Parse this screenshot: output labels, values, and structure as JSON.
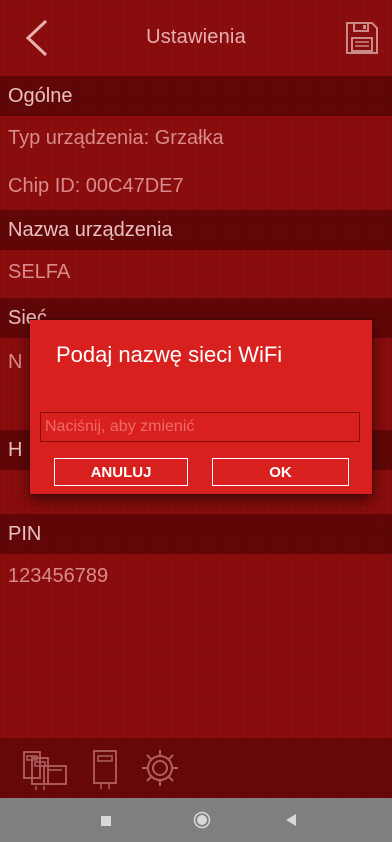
{
  "header": {
    "title": "Ustawienia",
    "back_icon": "chevron-left-icon",
    "save_icon": "floppy-disk-icon"
  },
  "rows": [
    {
      "text": "Ogólne",
      "kind": "head"
    },
    {
      "text": "Typ urządzenia: Grzałka",
      "kind": "val"
    },
    {
      "text": "Chip ID: 00C47DE7",
      "kind": "val"
    },
    {
      "text": "Nazwa urządzenia",
      "kind": "head"
    },
    {
      "text": "SELFA",
      "kind": "val"
    },
    {
      "text": "Sieć",
      "kind": "head"
    },
    {
      "text": "N",
      "kind": "val"
    },
    {
      "text": "",
      "kind": "faint"
    },
    {
      "text": "H",
      "kind": "head"
    },
    {
      "text": "",
      "kind": "val"
    },
    {
      "text": "PIN",
      "kind": "head"
    },
    {
      "text": "123456789",
      "kind": "val"
    }
  ],
  "dialog": {
    "title": "Podaj nazwę sieci WiFi",
    "input_placeholder": "Naciśnij, aby zmienić",
    "input_value": "",
    "cancel_label": "ANULUJ",
    "ok_label": "OK"
  },
  "bottom_tabs": [
    {
      "icon": "devices-icon"
    },
    {
      "icon": "device-icon"
    },
    {
      "icon": "gear-icon"
    }
  ],
  "system_nav": {
    "icons": [
      "square-icon",
      "circle-icon",
      "triangle-back-icon"
    ]
  },
  "colors": {
    "background": "#8c0d0d",
    "dialog": "#d8201e",
    "navbar": "#7f7f7f"
  }
}
